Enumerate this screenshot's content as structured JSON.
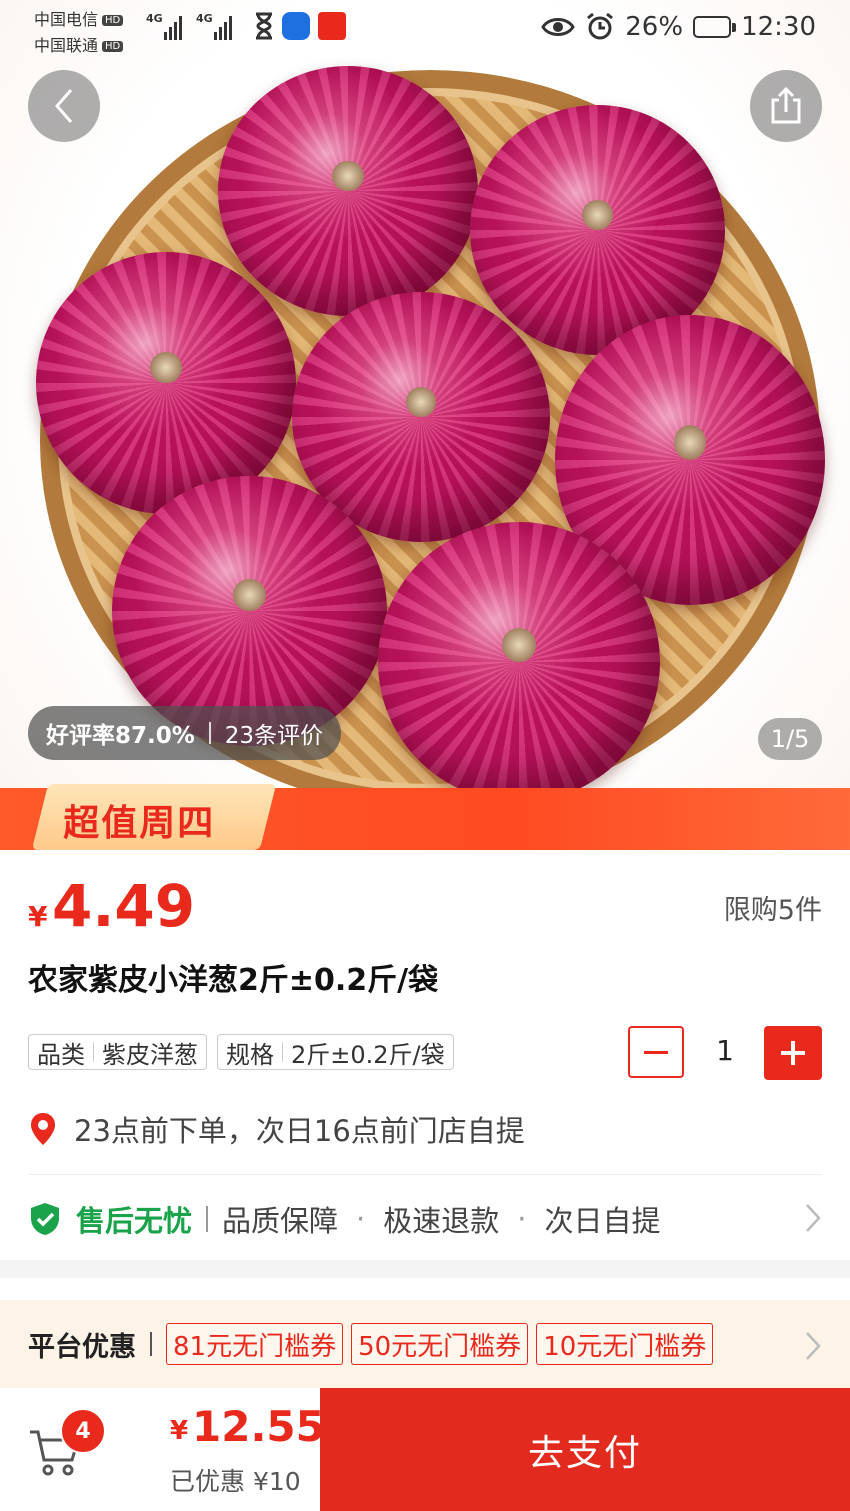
{
  "status_bar": {
    "carrier1": "中国电信",
    "carrier2": "中国联通",
    "hd_label": "HD",
    "network1": "4G",
    "network2": "4G",
    "battery": "26%",
    "time": "12:30"
  },
  "gallery": {
    "rating": "好评率87.0%",
    "reviews": "23条评价",
    "counter": "1/5",
    "promo_tag": "超值周四"
  },
  "product": {
    "currency": "¥",
    "price": "4.49",
    "limit": "限购5件",
    "title": "农家紫皮小洋葱2斤±0.2斤/袋",
    "specs": [
      {
        "name": "品类",
        "value": "紫皮洋葱"
      },
      {
        "name": "规格",
        "value": "2斤±0.2斤/袋"
      }
    ],
    "quantity": "1",
    "pickup": "23点前下单，次日16点前门店自提"
  },
  "service": {
    "title": "售后无忧",
    "items": [
      "品质保障",
      "极速退款",
      "次日自提"
    ]
  },
  "coupons": {
    "label": "平台优惠",
    "items": [
      "81元无门槛券",
      "50元无门槛券",
      "10元无门槛券"
    ]
  },
  "bottom_bar": {
    "cart_count": "4",
    "currency": "¥",
    "total": "12.55",
    "saved": "已优惠 ¥10",
    "pay_label": "去支付"
  },
  "colors": {
    "accent": "#e8291c",
    "service_green": "#1aa34a",
    "coupon_bg": "#fdf3e6"
  }
}
